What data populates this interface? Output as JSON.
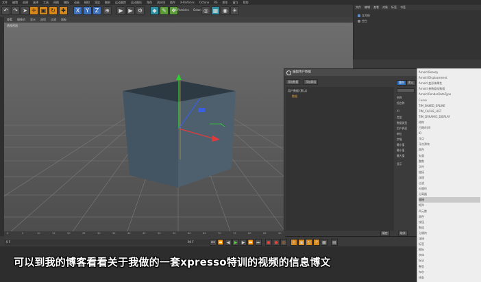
{
  "menubar": [
    "文件",
    "编辑",
    "创建",
    "选择",
    "工具",
    "网格",
    "捕捉",
    "动画",
    "模拟",
    "渲染",
    "雕刻",
    "运动跟踪",
    "运动图形",
    "角色",
    "流水线",
    "插件",
    "X-Particles",
    "Octane",
    "RS",
    "脚本",
    "窗口",
    "帮助"
  ],
  "toolbar": {
    "xyz": [
      "X",
      "Y",
      "Z"
    ],
    "plugin_label": "X-Particles",
    "octane_label": "Octane"
  },
  "viewport": {
    "menu": [
      "查看",
      "摄像机",
      "显示",
      "选项",
      "过滤",
      "面板"
    ],
    "label": "透视视图"
  },
  "object_manager": {
    "menu": [
      "文件",
      "编辑",
      "查看",
      "对象",
      "标签",
      "书签"
    ],
    "rows": [
      "立方体",
      "空白"
    ]
  },
  "dialog": {
    "title": "编辑用户数据",
    "buttons": [
      "添加数据",
      "添加群组"
    ],
    "tree": [
      "用户数据 (默认)",
      "数据"
    ],
    "side_buttons": [
      "属性",
      "默认"
    ],
    "side_labels": [
      "名称",
      "短名称",
      "",
      "ID",
      "类型",
      "数据类型",
      "用户界面",
      "单位",
      "步幅",
      "最小值",
      "最小值",
      "最大值",
      "显示"
    ],
    "ok": "确定",
    "cancel": "取消"
  },
  "dropdown": [
    "Arnold Beauty",
    "Arnold Displacement",
    "Arnold 变形体属性",
    "Arnold 参数驱动数据",
    "Arnold RenderDataType",
    "Curve",
    "TIM_BAKED_SPLINE",
    "TIM_CACHE_LIST",
    "TIM_DYNAMIC_DISPLAY",
    "结构",
    "日期/时间",
    "ID",
    "浮点",
    "浮点滑块",
    "颜色",
    "矢量",
    "整数",
    "字符",
    "链接",
    "纹理",
    "过滤",
    "分隔符",
    "分离器",
    "链接",
    "矩阵",
    "四元数",
    "颜色",
    "按钮",
    "数组",
    "分隔符",
    "连接",
    "标签",
    "图标",
    "字体",
    "标记",
    "整型",
    "布尔",
    "线条"
  ],
  "dropdown_selected": 23,
  "timeline": {
    "ticks": [
      "0",
      "5",
      "10",
      "15",
      "20",
      "25",
      "30",
      "35",
      "40",
      "45",
      "50",
      "55",
      "60",
      "65",
      "70",
      "75",
      "80",
      "85",
      "90"
    ],
    "start": "0 F",
    "end": "90 F"
  },
  "subtitle": "可以到我的博客看看关于我做的一套xpresso特训的视频的信息博文"
}
